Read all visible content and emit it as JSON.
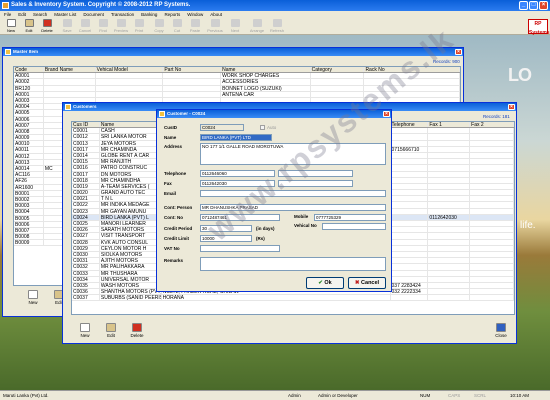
{
  "app": {
    "title": "Sales & Inventory System. Copyright © 2008-2012 RP Systems.",
    "brand": "RP Systems"
  },
  "menu": [
    "File",
    "Edit",
    "Search",
    "Master List",
    "Document",
    "Transaction",
    "Banking",
    "Reports",
    "Window",
    "About"
  ],
  "toolbar": [
    {
      "label": "New",
      "enabled": true
    },
    {
      "label": "Edit",
      "enabled": true
    },
    {
      "label": "Delete",
      "enabled": true
    },
    {
      "label": "Save",
      "enabled": false
    },
    {
      "label": "Cancel",
      "enabled": false
    },
    {
      "label": "Find",
      "enabled": false
    },
    {
      "label": "Preview",
      "enabled": false
    },
    {
      "label": "Print",
      "enabled": false
    },
    {
      "label": "Copy",
      "enabled": false
    },
    {
      "label": "Cut",
      "enabled": false
    },
    {
      "label": "Paste",
      "enabled": false
    },
    {
      "label": "Previous",
      "enabled": false
    },
    {
      "label": "Next",
      "enabled": false
    },
    {
      "label": "Arrange",
      "enabled": false
    },
    {
      "label": "Refresh",
      "enabled": false
    }
  ],
  "master": {
    "title": "Master Item",
    "records": "Records: 900",
    "columns": [
      "Code",
      "Brand Name",
      "Vehical Model",
      "Part No",
      "Name",
      "Category",
      "Rack No"
    ],
    "rows": [
      [
        "A0001",
        "",
        "",
        "",
        "WORK SHOP CHARGES",
        "",
        ""
      ],
      [
        "A0002",
        "",
        "",
        "",
        "ACCESSORIES",
        "",
        ""
      ],
      [
        "BR120",
        "",
        "",
        "",
        "BONNET LOGO (SUZUKI)",
        "",
        ""
      ],
      [
        "A0001",
        "",
        "",
        "",
        "ANTENA CAR",
        "",
        ""
      ],
      [
        "A0003",
        "",
        "",
        "",
        "",
        "",
        ""
      ],
      [
        "A0004",
        "",
        "",
        "",
        "",
        "",
        ""
      ],
      [
        "A0005",
        "",
        "",
        "",
        "",
        "",
        ""
      ],
      [
        "A0006",
        "",
        "",
        "",
        "",
        "",
        ""
      ],
      [
        "A0007",
        "",
        "",
        "",
        "",
        "",
        ""
      ],
      [
        "A0008",
        "",
        "",
        "",
        "",
        "",
        ""
      ],
      [
        "A0009",
        "",
        "",
        "",
        "",
        "",
        ""
      ],
      [
        "A0010",
        "",
        "",
        "",
        "",
        "",
        ""
      ],
      [
        "A0011",
        "",
        "",
        "",
        "",
        "",
        ""
      ],
      [
        "A0012",
        "",
        "",
        "",
        "",
        "",
        ""
      ],
      [
        "A0013",
        "",
        "",
        "",
        "",
        "",
        ""
      ],
      [
        "A0014",
        "MC",
        "",
        "",
        "",
        "",
        ""
      ],
      [
        "AC116",
        "",
        "",
        "",
        "",
        "",
        ""
      ],
      [
        "AF26",
        "",
        "",
        "",
        "",
        "",
        ""
      ],
      [
        "AR1600",
        "",
        "",
        "",
        "",
        "",
        ""
      ],
      [
        "B0001",
        "",
        "",
        "",
        "",
        "",
        ""
      ],
      [
        "B0002",
        "",
        "",
        "",
        "",
        "",
        ""
      ],
      [
        "B0003",
        "",
        "",
        "",
        "",
        "",
        ""
      ],
      [
        "B0004",
        "",
        "",
        "",
        "",
        "",
        ""
      ],
      [
        "B0005",
        "",
        "",
        "",
        "",
        "",
        ""
      ],
      [
        "B0006",
        "",
        "",
        "",
        "",
        "",
        ""
      ],
      [
        "B0007",
        "",
        "",
        "",
        "",
        "",
        ""
      ],
      [
        "B0008",
        "",
        "",
        "",
        "",
        "",
        ""
      ],
      [
        "B0009",
        "",
        "",
        "",
        "",
        "",
        ""
      ]
    ],
    "buttons": [
      "New",
      "Edit"
    ]
  },
  "customers": {
    "title": "Customers",
    "records": "Records: 181",
    "columns": [
      "Cus ID",
      "Name",
      "",
      "Telephone",
      "Fax 1",
      "Fax 2"
    ],
    "rows": [
      [
        "C0001",
        "CASH",
        "",
        "",
        "",
        ""
      ],
      [
        "C0012",
        "SRI LANKA MOTOR",
        "",
        "",
        "",
        ""
      ],
      [
        "C0013",
        "JEYA MOTORS",
        "",
        "",
        "",
        ""
      ],
      [
        "C0017",
        "MR CHAMINDA",
        "",
        "0715666710",
        "",
        ""
      ],
      [
        "C0014",
        "GLOBE RENT A CAR",
        "",
        "",
        "",
        ""
      ],
      [
        "C0015",
        "MR RANJITH",
        "",
        "",
        "",
        ""
      ],
      [
        "C0016",
        "PATRO CONSTRUC",
        "",
        "",
        "",
        ""
      ],
      [
        "C0017",
        "DN MOTORS",
        "",
        "",
        "",
        ""
      ],
      [
        "C0018",
        "MR CHAMINDHA",
        "",
        "",
        "",
        ""
      ],
      [
        "C0019",
        "A-TEAM SERVICES (",
        "",
        "",
        "",
        ""
      ],
      [
        "C0020",
        "GRAND AUTO TEC",
        "",
        "",
        "",
        ""
      ],
      [
        "C0021",
        "T N L",
        "",
        "",
        "",
        ""
      ],
      [
        "C0022",
        "MR INDIKA MEDAGE",
        "",
        "",
        "",
        ""
      ],
      [
        "C0023",
        "MR GAYAN AMUNU",
        "",
        "",
        "",
        ""
      ],
      [
        "C0024",
        "BIRD LANKA (PVT) L",
        "",
        "",
        "0112642030",
        ""
      ],
      [
        "C0025",
        "MANORI LEARNER",
        "",
        "",
        "",
        ""
      ],
      [
        "C0026",
        "SARATH MOTORS",
        "",
        "",
        "",
        ""
      ],
      [
        "C0027",
        "VISIT TRANSPORT",
        "",
        "",
        "",
        ""
      ],
      [
        "C0028",
        "KVK AUTO CONSUL",
        "",
        "",
        "",
        ""
      ],
      [
        "C0029",
        "CEYLON MOTOR H",
        "",
        "",
        "",
        ""
      ],
      [
        "C0030",
        "SIOLKA MOTORS",
        "",
        "",
        "",
        ""
      ],
      [
        "C0031",
        "AJITH MOTORS",
        "",
        "",
        "",
        ""
      ],
      [
        "C0032",
        "MR PALIHAKKARA",
        "",
        "",
        "",
        ""
      ],
      [
        "C0033",
        "MR THUSHARA",
        "",
        "",
        "",
        ""
      ],
      [
        "C0034",
        "UNIVERSAL MOTOR",
        "",
        "",
        "",
        ""
      ],
      [
        "C0035",
        "WASH MOTORS",
        "NO277, MADAMPE ROAD, KULIYAPITIYA",
        "037 2283424",
        "",
        ""
      ],
      [
        "C0036",
        "SHANTHA MOTORS (PVT) LTD",
        "NO272, FRAZER ROAD, CHILAW",
        "032 2222334",
        "",
        ""
      ],
      [
        "C0037",
        "SUBURBS (SANID PEERIS)",
        "HORANA",
        "",
        "",
        ""
      ]
    ],
    "buttons": [
      "New",
      "Edit",
      "Delete",
      "Close"
    ]
  },
  "dialog": {
    "title": "Customer - C0024",
    "labels": {
      "cusid": "CusID",
      "auto": "Auto",
      "name": "Name",
      "address": "Address",
      "tel": "Telephone",
      "fax": "Fax",
      "email": "Email",
      "contperson": "Cont: Person",
      "contno": "Cont: No",
      "mobile": "Mobile",
      "vehicalno": "Vehical No",
      "creditperiod": "Credit Period",
      "days": "(in days)",
      "creditlimit": "Credit Limit",
      "rs": "(Rs)",
      "vatno": "VAT No",
      "remarks": "Remarks"
    },
    "values": {
      "cusid": "C0024",
      "name": "BIRD LANKA (PVT) LTD",
      "address": "NO 177 1/1 GALLE ROAD MOROTUWA",
      "tel": "0112646060",
      "fax": "0112642030",
      "email": "",
      "contperson": "MR DHANUSHKA PRASAD",
      "contno": "0712487461",
      "mobile": "0777725329",
      "vehicalno": "",
      "creditperiod": "30",
      "creditlimit": "10000",
      "vatno": "",
      "remarks": ""
    },
    "ok": "Ok",
    "cancel": "Cancel"
  },
  "status": {
    "company": "Maruti Lanka (Pvt) Ltd.",
    "user": "Admin",
    "role": "Admin or Developer",
    "num": "NUM",
    "caps": "CAPS",
    "scrl": "SCRL",
    "time": "10:10 AM"
  },
  "watermark": "www.rpsystems.lk",
  "desktop_text": {
    "lo": "LO",
    "life": "life."
  }
}
